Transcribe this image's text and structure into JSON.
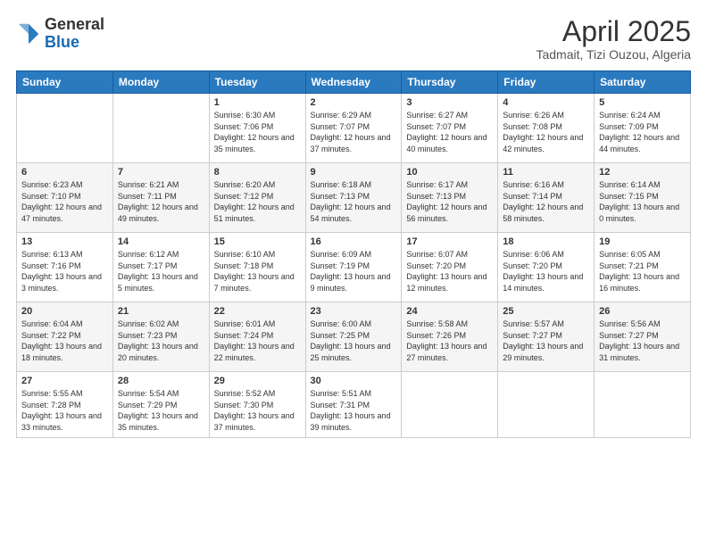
{
  "logo": {
    "general": "General",
    "blue": "Blue"
  },
  "header": {
    "month_title": "April 2025",
    "subtitle": "Tadmait, Tizi Ouzou, Algeria"
  },
  "weekdays": [
    "Sunday",
    "Monday",
    "Tuesday",
    "Wednesday",
    "Thursday",
    "Friday",
    "Saturday"
  ],
  "weeks": [
    [
      {
        "day": "",
        "sunrise": "",
        "sunset": "",
        "daylight": ""
      },
      {
        "day": "",
        "sunrise": "",
        "sunset": "",
        "daylight": ""
      },
      {
        "day": "1",
        "sunrise": "Sunrise: 6:30 AM",
        "sunset": "Sunset: 7:06 PM",
        "daylight": "Daylight: 12 hours and 35 minutes."
      },
      {
        "day": "2",
        "sunrise": "Sunrise: 6:29 AM",
        "sunset": "Sunset: 7:07 PM",
        "daylight": "Daylight: 12 hours and 37 minutes."
      },
      {
        "day": "3",
        "sunrise": "Sunrise: 6:27 AM",
        "sunset": "Sunset: 7:07 PM",
        "daylight": "Daylight: 12 hours and 40 minutes."
      },
      {
        "day": "4",
        "sunrise": "Sunrise: 6:26 AM",
        "sunset": "Sunset: 7:08 PM",
        "daylight": "Daylight: 12 hours and 42 minutes."
      },
      {
        "day": "5",
        "sunrise": "Sunrise: 6:24 AM",
        "sunset": "Sunset: 7:09 PM",
        "daylight": "Daylight: 12 hours and 44 minutes."
      }
    ],
    [
      {
        "day": "6",
        "sunrise": "Sunrise: 6:23 AM",
        "sunset": "Sunset: 7:10 PM",
        "daylight": "Daylight: 12 hours and 47 minutes."
      },
      {
        "day": "7",
        "sunrise": "Sunrise: 6:21 AM",
        "sunset": "Sunset: 7:11 PM",
        "daylight": "Daylight: 12 hours and 49 minutes."
      },
      {
        "day": "8",
        "sunrise": "Sunrise: 6:20 AM",
        "sunset": "Sunset: 7:12 PM",
        "daylight": "Daylight: 12 hours and 51 minutes."
      },
      {
        "day": "9",
        "sunrise": "Sunrise: 6:18 AM",
        "sunset": "Sunset: 7:13 PM",
        "daylight": "Daylight: 12 hours and 54 minutes."
      },
      {
        "day": "10",
        "sunrise": "Sunrise: 6:17 AM",
        "sunset": "Sunset: 7:13 PM",
        "daylight": "Daylight: 12 hours and 56 minutes."
      },
      {
        "day": "11",
        "sunrise": "Sunrise: 6:16 AM",
        "sunset": "Sunset: 7:14 PM",
        "daylight": "Daylight: 12 hours and 58 minutes."
      },
      {
        "day": "12",
        "sunrise": "Sunrise: 6:14 AM",
        "sunset": "Sunset: 7:15 PM",
        "daylight": "Daylight: 13 hours and 0 minutes."
      }
    ],
    [
      {
        "day": "13",
        "sunrise": "Sunrise: 6:13 AM",
        "sunset": "Sunset: 7:16 PM",
        "daylight": "Daylight: 13 hours and 3 minutes."
      },
      {
        "day": "14",
        "sunrise": "Sunrise: 6:12 AM",
        "sunset": "Sunset: 7:17 PM",
        "daylight": "Daylight: 13 hours and 5 minutes."
      },
      {
        "day": "15",
        "sunrise": "Sunrise: 6:10 AM",
        "sunset": "Sunset: 7:18 PM",
        "daylight": "Daylight: 13 hours and 7 minutes."
      },
      {
        "day": "16",
        "sunrise": "Sunrise: 6:09 AM",
        "sunset": "Sunset: 7:19 PM",
        "daylight": "Daylight: 13 hours and 9 minutes."
      },
      {
        "day": "17",
        "sunrise": "Sunrise: 6:07 AM",
        "sunset": "Sunset: 7:20 PM",
        "daylight": "Daylight: 13 hours and 12 minutes."
      },
      {
        "day": "18",
        "sunrise": "Sunrise: 6:06 AM",
        "sunset": "Sunset: 7:20 PM",
        "daylight": "Daylight: 13 hours and 14 minutes."
      },
      {
        "day": "19",
        "sunrise": "Sunrise: 6:05 AM",
        "sunset": "Sunset: 7:21 PM",
        "daylight": "Daylight: 13 hours and 16 minutes."
      }
    ],
    [
      {
        "day": "20",
        "sunrise": "Sunrise: 6:04 AM",
        "sunset": "Sunset: 7:22 PM",
        "daylight": "Daylight: 13 hours and 18 minutes."
      },
      {
        "day": "21",
        "sunrise": "Sunrise: 6:02 AM",
        "sunset": "Sunset: 7:23 PM",
        "daylight": "Daylight: 13 hours and 20 minutes."
      },
      {
        "day": "22",
        "sunrise": "Sunrise: 6:01 AM",
        "sunset": "Sunset: 7:24 PM",
        "daylight": "Daylight: 13 hours and 22 minutes."
      },
      {
        "day": "23",
        "sunrise": "Sunrise: 6:00 AM",
        "sunset": "Sunset: 7:25 PM",
        "daylight": "Daylight: 13 hours and 25 minutes."
      },
      {
        "day": "24",
        "sunrise": "Sunrise: 5:58 AM",
        "sunset": "Sunset: 7:26 PM",
        "daylight": "Daylight: 13 hours and 27 minutes."
      },
      {
        "day": "25",
        "sunrise": "Sunrise: 5:57 AM",
        "sunset": "Sunset: 7:27 PM",
        "daylight": "Daylight: 13 hours and 29 minutes."
      },
      {
        "day": "26",
        "sunrise": "Sunrise: 5:56 AM",
        "sunset": "Sunset: 7:27 PM",
        "daylight": "Daylight: 13 hours and 31 minutes."
      }
    ],
    [
      {
        "day": "27",
        "sunrise": "Sunrise: 5:55 AM",
        "sunset": "Sunset: 7:28 PM",
        "daylight": "Daylight: 13 hours and 33 minutes."
      },
      {
        "day": "28",
        "sunrise": "Sunrise: 5:54 AM",
        "sunset": "Sunset: 7:29 PM",
        "daylight": "Daylight: 13 hours and 35 minutes."
      },
      {
        "day": "29",
        "sunrise": "Sunrise: 5:52 AM",
        "sunset": "Sunset: 7:30 PM",
        "daylight": "Daylight: 13 hours and 37 minutes."
      },
      {
        "day": "30",
        "sunrise": "Sunrise: 5:51 AM",
        "sunset": "Sunset: 7:31 PM",
        "daylight": "Daylight: 13 hours and 39 minutes."
      },
      {
        "day": "",
        "sunrise": "",
        "sunset": "",
        "daylight": ""
      },
      {
        "day": "",
        "sunrise": "",
        "sunset": "",
        "daylight": ""
      },
      {
        "day": "",
        "sunrise": "",
        "sunset": "",
        "daylight": ""
      }
    ]
  ]
}
